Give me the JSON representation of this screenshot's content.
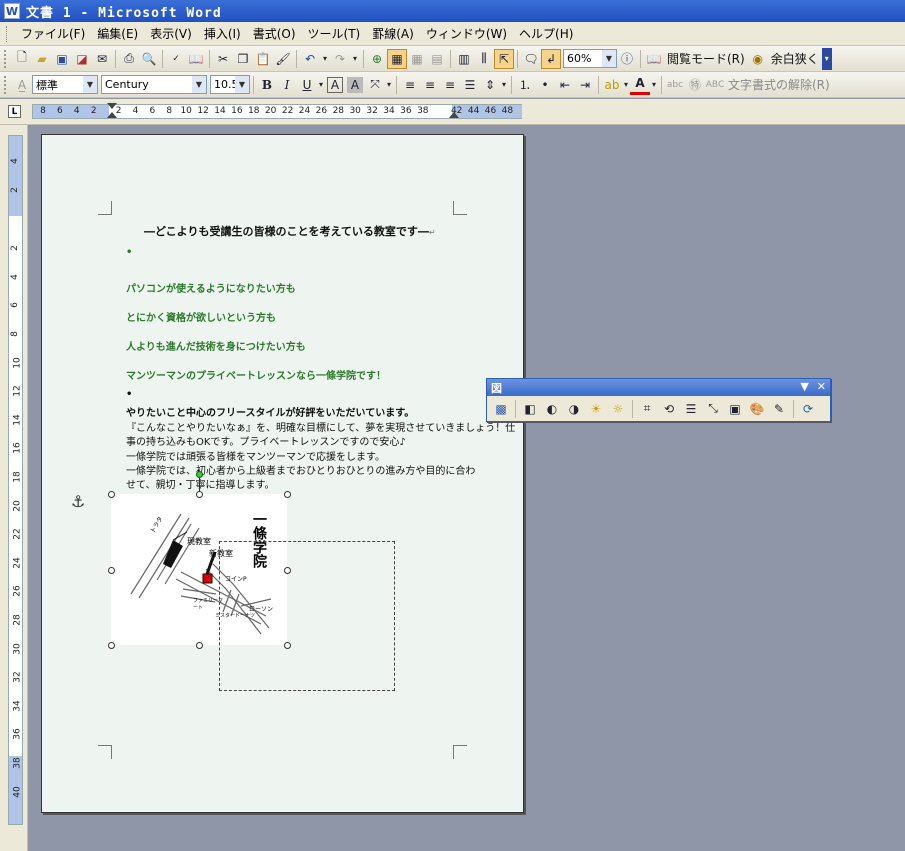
{
  "window": {
    "title": "文書 1 - Microsoft Word",
    "app_icon": "W"
  },
  "menu": [
    "ファイル(F)",
    "編集(E)",
    "表示(V)",
    "挿入(I)",
    "書式(O)",
    "ツール(T)",
    "罫線(A)",
    "ウィンドウ(W)",
    "ヘルプ(H)"
  ],
  "standard_toolbar": {
    "zoom": "60%",
    "reading_mode": "閲覧モード(R)",
    "margin_narrow": "余白狭く"
  },
  "format_toolbar": {
    "style": "標準",
    "font": "Century",
    "size": "10.5",
    "clear_format": "文字書式の解除(R)",
    "bold": "B",
    "italic": "I",
    "underline": "U",
    "char_a": "A",
    "char_a2": "A",
    "char_a3": "A"
  },
  "ruler": {
    "corner": "L",
    "h_numbers": [
      "8",
      "6",
      "4",
      "2",
      "2",
      "4",
      "6",
      "8",
      "10",
      "12",
      "14",
      "16",
      "18",
      "20",
      "22",
      "24",
      "26",
      "28",
      "30",
      "32",
      "34",
      "36",
      "38",
      "42",
      "44",
      "46",
      "48"
    ],
    "v_numbers": [
      "4",
      "2",
      "2",
      "4",
      "6",
      "8",
      "10",
      "12",
      "14",
      "16",
      "18",
      "20",
      "22",
      "24",
      "26",
      "28",
      "30",
      "32",
      "34",
      "36",
      "38",
      "40"
    ]
  },
  "document": {
    "title": "―どこよりも受講生の皆様のことを考えている教室です―",
    "lines_green": [
      "パソコンが使えるようになりたい方も",
      "とにかく資格が欲しいという方も",
      "人よりも進んだ技術を身につけたい方も",
      "マンツーマンのプライベートレッスンなら一條学院です！"
    ],
    "body": [
      "やりたいこと中心のフリースタイルが好評をいただいています。",
      "『こんなことやりたいなぁ』を、明確な目標にして、夢を実現させていきましょう！仕",
      "事の持ち込みもOKです。プライベートレッスンですので安心♪",
      "一條学院では頑張る皆様をマンツーマンで応援をします。",
      "一條学院では、初心者から上級者までおひとりおひとりの進み方や目的に合わ",
      "せて、親切・丁寧に指導します。"
    ],
    "para_mark": "↵",
    "bullet": "•"
  },
  "map": {
    "school_name": "一條学院",
    "labels": [
      "現教室",
      "新教室",
      "トラタ",
      "コインP",
      "ローソン",
      "ファミリーマート",
      "ミスタードーナツ"
    ]
  },
  "picture_toolbar": {
    "title": "図",
    "dropdown": "▼",
    "close": "✕"
  }
}
